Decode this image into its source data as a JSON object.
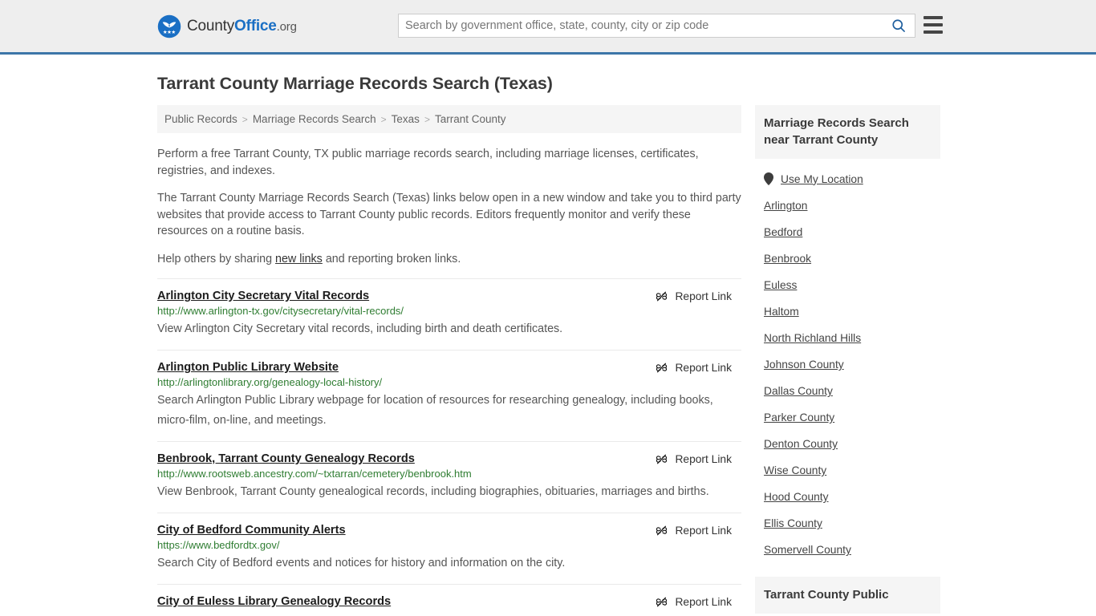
{
  "header": {
    "logo": {
      "icon": "eagle-seal-icon",
      "part1": "County",
      "part2": "Office",
      "part3": ".org"
    },
    "search": {
      "placeholder": "Search by government office, state, county, city or zip code",
      "value": "",
      "icon": "search-icon"
    },
    "menu_icon": "hamburger-menu-icon",
    "accent_color": "#3d76a8"
  },
  "page": {
    "title": "Tarrant County Marriage Records Search (Texas)"
  },
  "breadcrumb": {
    "separator": ">",
    "items": [
      {
        "label": "Public Records"
      },
      {
        "label": "Marriage Records Search"
      },
      {
        "label": "Texas"
      },
      {
        "label": "Tarrant County"
      }
    ]
  },
  "intro": {
    "paragraph1": "Perform a free Tarrant County, TX public marriage records search, including marriage licenses, certificates, registries, and indexes.",
    "paragraph2": "The Tarrant County Marriage Records Search (Texas) links below open in a new window and take you to third party websites that provide access to Tarrant County public records. Editors frequently monitor and verify these resources on a routine basis.",
    "paragraph3_before": "Help others by sharing ",
    "paragraph3_link": "new links",
    "paragraph3_after": " and reporting broken links."
  },
  "report": {
    "label": "Report Link",
    "icon": "broken-link-icon"
  },
  "links": [
    {
      "title": "Arlington City Secretary Vital Records",
      "url": "http://www.arlington-tx.gov/citysecretary/vital-records/",
      "description": "View Arlington City Secretary vital records, including birth and death certificates."
    },
    {
      "title": "Arlington Public Library Website",
      "url": "http://arlingtonlibrary.org/genealogy-local-history/",
      "description": "Search Arlington Public Library webpage for location of resources for researching genealogy, including books, micro-film, on-line, and meetings."
    },
    {
      "title": "Benbrook, Tarrant County Genealogy Records",
      "url": "http://www.rootsweb.ancestry.com/~txtarran/cemetery/benbrook.htm",
      "description": "View Benbrook, Tarrant County genealogical records, including biographies, obituaries, marriages and births."
    },
    {
      "title": "City of Bedford Community Alerts",
      "url": "https://www.bedfordtx.gov/",
      "description": "Search City of Bedford events and notices for history and information on the city."
    },
    {
      "title": "City of Euless Library Genealogy Records",
      "url": "",
      "description": ""
    }
  ],
  "sidebar": {
    "box1": {
      "header": "Marriage Records Search near Tarrant County",
      "location_link": {
        "label": "Use My Location",
        "icon": "map-pin-icon"
      },
      "items": [
        {
          "label": "Arlington"
        },
        {
          "label": "Bedford"
        },
        {
          "label": "Benbrook"
        },
        {
          "label": "Euless"
        },
        {
          "label": "Haltom"
        },
        {
          "label": "North Richland Hills"
        },
        {
          "label": "Johnson County"
        },
        {
          "label": "Dallas County"
        },
        {
          "label": "Parker County"
        },
        {
          "label": "Denton County"
        },
        {
          "label": "Wise County"
        },
        {
          "label": "Hood County"
        },
        {
          "label": "Ellis County"
        },
        {
          "label": "Somervell County"
        }
      ]
    },
    "box2": {
      "header": "Tarrant County Public"
    }
  }
}
